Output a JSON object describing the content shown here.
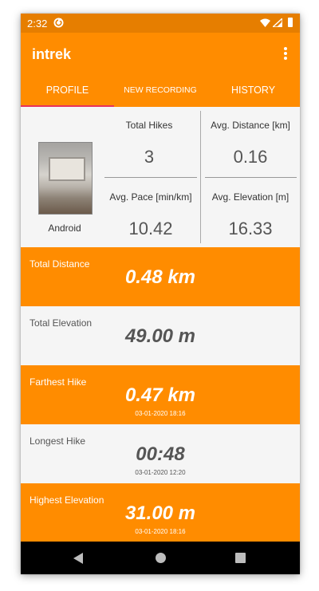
{
  "status_bar": {
    "time": "2:32"
  },
  "app_bar": {
    "title": "intrek"
  },
  "tabs": [
    {
      "label": "PROFILE",
      "selected": true
    },
    {
      "label": "NEW RECORDING",
      "selected": false
    },
    {
      "label": "HISTORY",
      "selected": false
    }
  ],
  "profile": {
    "username": "Android",
    "total_hikes_label": "Total Hikes",
    "total_hikes_value": "3",
    "avg_distance_label": "Avg. Distance [km]",
    "avg_distance_value": "0.16",
    "avg_pace_label": "Avg. Pace [min/km]",
    "avg_pace_value": "10.42",
    "avg_elevation_label": "Avg. Elevation [m]",
    "avg_elevation_value": "16.33"
  },
  "banners": [
    {
      "label": "Total Distance",
      "value": "0.48 km"
    },
    {
      "label": "Total Elevation",
      "value": "49.00 m"
    },
    {
      "label": "Farthest Hike",
      "value": "0.47 km",
      "date": "03-01-2020 18:16"
    },
    {
      "label": "Longest Hike",
      "value": "00:48",
      "date": "03-01-2020 12:20"
    },
    {
      "label": "Highest Elevation",
      "value": "31.00 m",
      "date": "03-01-2020 18:16"
    }
  ],
  "colors": {
    "primary": "#ff8c00",
    "primary_dark": "#e67e00",
    "tab_indicator": "#e8325c",
    "light_background": "#f5f5f5"
  },
  "icons": {
    "status": [
      "sync-icon",
      "wifi-icon",
      "signal-icon",
      "battery-icon"
    ],
    "app_bar": [
      "overflow-menu-icon"
    ],
    "navigation": [
      "back-icon",
      "home-icon",
      "recents-icon"
    ]
  }
}
